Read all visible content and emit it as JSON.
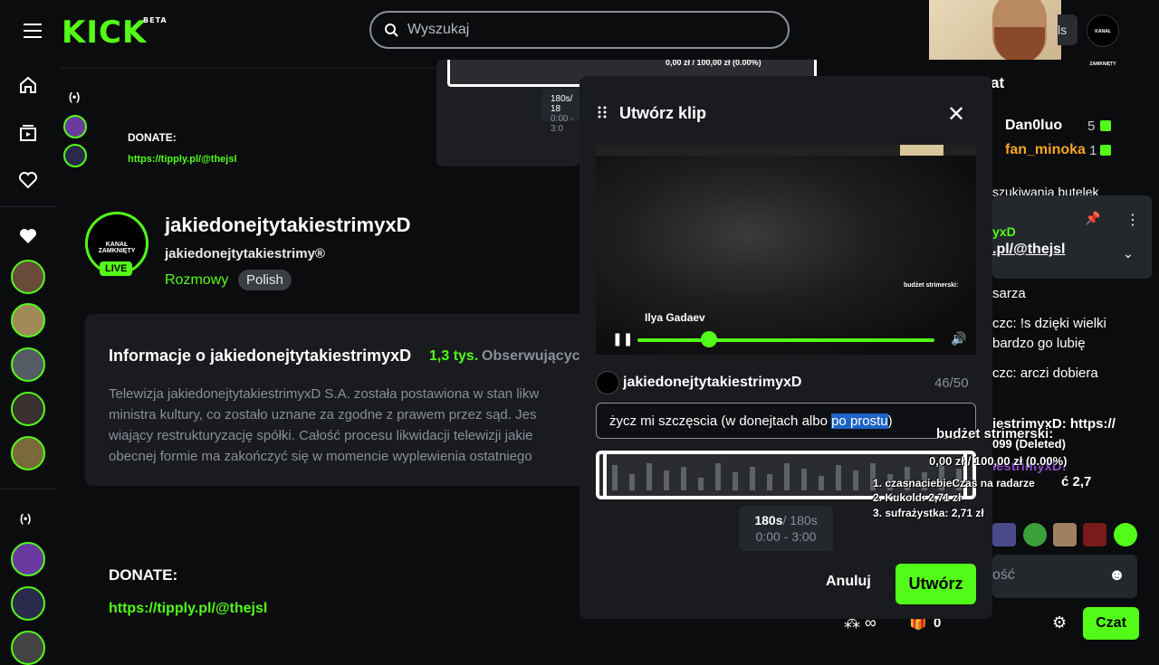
{
  "header": {
    "logo": "KICK",
    "logo_badge": "BETA",
    "search_placeholder": "Wyszukaj",
    "topright_partial": "ls",
    "avatar_text": "KANAŁ ZAMKNIĘTY"
  },
  "sidebar": {
    "items": [
      "home",
      "browse",
      "following"
    ],
    "following_heading_icon": "heart-icon"
  },
  "channel": {
    "name": "jakiedonejtytakiestrimyxD",
    "subtitle": "jakiedonejtytakiestrimy®",
    "category": "Rozmowy",
    "tag": "Polish",
    "live": "LIVE",
    "avatar_text": "KANAŁ ZAMKNIĘTY"
  },
  "about": {
    "title": "Informacje o jakiedonejtytakiestrimyxD",
    "followers": "1,3 tys.",
    "followers_label": "Obserwujących",
    "description": [
      "Telewizja jakiedonejtytakiestrimyxD S.A. została postawiona w stan likw",
      "ministra kultury, co zostało uznane za zgodne z prawem przez sąd. Jes",
      "wiający restrukturyzację spółki. Całość procesu likwidacji telewizji jakie",
      "obecnej formie ma zakończyć się w momencie wyplewienia ostatniego"
    ]
  },
  "donate": {
    "heading": "DONATE:",
    "link": "https://tipply.pl/@thejsl"
  },
  "modal": {
    "title": "Utwórz klip",
    "owner": "jakiedonejtytakiestrimyxD",
    "counter": "46/50",
    "input_before": "życz mi szczęscia (w donejtach albo ",
    "input_selected": "po prostu",
    "input_after": ")",
    "duration_selected": "180s",
    "duration_max": "/ 180s",
    "range": "0:00 - 3:00",
    "cancel_label": "Anuluj",
    "create_label": "Utwórz",
    "video_overlay_name": "Ilya Gadaev",
    "video_overlay_budget": "budżet strimerski:"
  },
  "background_clip": {
    "duration": "180s/ 18",
    "range": "0:00 - 3:0",
    "budget": "0,00 zł / 100,00 zł (0.00%)"
  },
  "chat": {
    "heading": "at",
    "users": [
      {
        "name": "Dan0luo",
        "count": "5"
      },
      {
        "name": "fan_minoka",
        "count": "1"
      }
    ],
    "partial_line": "szukiwania butelek",
    "pinned_user": "yxD",
    "pinned_link": ".pl/@thejsl",
    "lines": [
      "sarza",
      "czc: !s dzięki wielki",
      "bardzo go lubię",
      "czc: arczi dobiera",
      "iestrimyxD: https://",
      "099 (Deleted)",
      "iestrimyxD:",
      "ć 2,7"
    ],
    "input_placeholder": "ość",
    "send_label": "Czat",
    "footer_count": "0"
  },
  "overlay": {
    "budget_title": "budżet strimerski:",
    "budget_value": "0,00 zł / 100,00 zł (0.00%)",
    "rank1": "1. czasnaciebieCzas na radarze",
    "rank1_val": "2,7",
    "rank2": "2. Kukold: 2,71 zł",
    "rank3": "3. sufrażystka: 2,71 zł"
  },
  "colors": {
    "accent": "#53fc18",
    "background": "#0b0c0e",
    "card": "#191b1f"
  }
}
